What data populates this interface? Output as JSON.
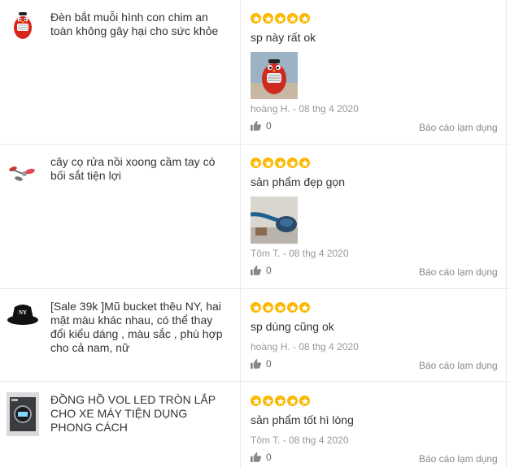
{
  "reviews": [
    {
      "product_name": "Đèn bắt muỗi hình con chim an toàn không gây hại cho sức khỏe",
      "rating": 5,
      "comment": "sp này rất ok",
      "author_date": "hoàng H. - 08 thg 4 2020",
      "likes": "0",
      "report_label": "Báo cáo lạm dụng",
      "has_image": true
    },
    {
      "product_name": "cây cọ rửa nồi xoong cầm tay có bối sắt tiện lợi",
      "rating": 5,
      "comment": "sản phẩm đẹp gọn",
      "author_date": "Tôm T. - 08 thg 4 2020",
      "likes": "0",
      "report_label": "Báo cáo lạm dụng",
      "has_image": true
    },
    {
      "product_name": "[Sale 39k ]Mũ bucket thêu NY, hai mặt màu khác nhau, có thể thay đổi kiểu dáng , màu sắc , phù hợp cho cả nam, nữ",
      "rating": 5,
      "comment": "sp dùng cũng ok",
      "author_date": "hoàng H. - 08 thg 4 2020",
      "likes": "0",
      "report_label": "Báo cáo lạm dụng",
      "has_image": false
    },
    {
      "product_name": "ĐỒNG HỒ VOL LED TRÒN LẮP CHO XE MÁY TIỆN DỤNG PHONG CÁCH",
      "rating": 5,
      "comment": "sản phẩm tốt hì lòng",
      "author_date": "Tôm T. - 08 thg 4 2020",
      "likes": "0",
      "report_label": "Báo cáo lạm dụng",
      "has_image": false
    }
  ],
  "colors": {
    "star": "#fcb800",
    "divider": "#e8e8e8",
    "meta": "#999999"
  },
  "icons": {
    "star": "star-icon",
    "like": "thumbs-up-icon"
  }
}
